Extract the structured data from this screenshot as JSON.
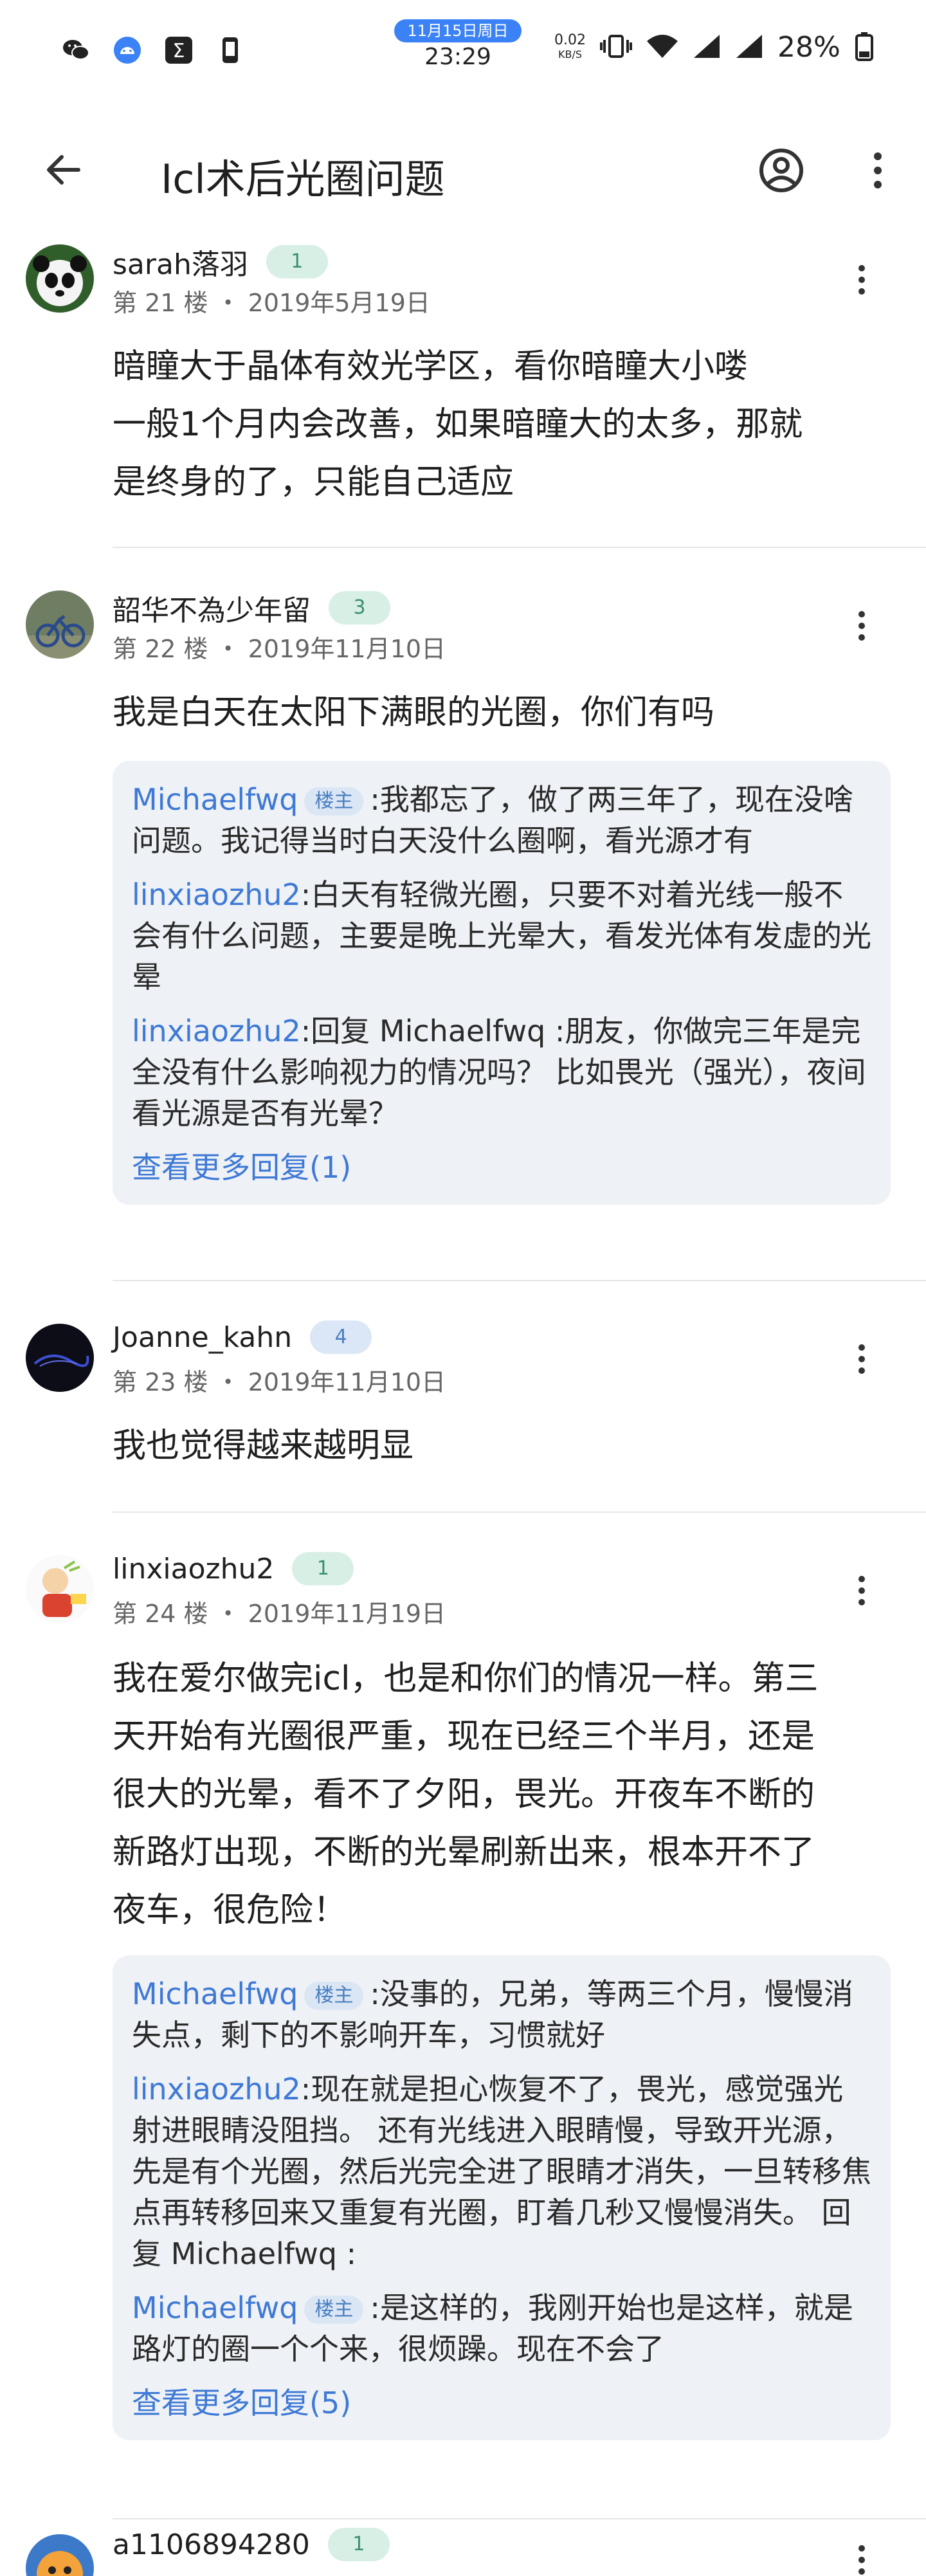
{
  "status_bar": {
    "date": "11月15日周日",
    "time": "23:29",
    "net_speed_value": "0.02",
    "net_speed_unit": "KB/S",
    "battery": "28%",
    "left_icons": [
      "wechat-icon",
      "android-icon",
      "sigma-icon",
      "phone-icon"
    ]
  },
  "app_bar": {
    "title": "Icl术后光圈问题"
  },
  "posts": [
    {
      "user": "sarah落羽",
      "level": "1",
      "meta": "第 21 楼 ・ 2019年5月19日",
      "lines": [
        "暗瞳大于晶体有效光学区，看你暗瞳大小喽",
        "一般1个月内会改善，如果暗瞳大的太多，那就",
        "是终身的了，只能自己适应"
      ]
    },
    {
      "user": "韶华不為少年留",
      "level": "3",
      "meta": "第 22 楼 ・ 2019年11月10日",
      "lines": [
        "我是白天在太阳下满眼的光圈，你们有吗"
      ],
      "replies": [
        {
          "user": "Michaelfwq",
          "badge": "楼主",
          "text": ":我都忘了，做了两三年了，现在没啥问题。我记得当时白天没什么圈啊，看光源才有"
        },
        {
          "user": "linxiaozhu2",
          "text": ":白天有轻微光圈，只要不对着光线一般不会有什么问题，主要是晚上光晕大，看发光体有发虚的光晕"
        },
        {
          "user": "linxiaozhu2",
          "text": ":回复 Michaelfwq :朋友，你做完三年是完全没有什么影响视力的情况吗？ 比如畏光（强光），夜间看光源是否有光晕？"
        }
      ],
      "more_replies": "查看更多回复(1)"
    },
    {
      "user": "Joanne_kahn",
      "level": "4",
      "meta": "第 23 楼 ・ 2019年11月10日",
      "lines": [
        "我也觉得越来越明显"
      ]
    },
    {
      "user": "linxiaozhu2",
      "level": "1",
      "meta": "第 24 楼 ・ 2019年11月19日",
      "lines": [
        "我在爱尔做完icl，也是和你们的情况一样。第三",
        "天开始有光圈很严重，现在已经三个半月，还是",
        "很大的光晕，看不了夕阳，畏光。开夜车不断的",
        "新路灯出现，不断的光晕刷新出来，根本开不了",
        "夜车，很危险！"
      ],
      "replies": [
        {
          "user": "Michaelfwq",
          "badge": "楼主",
          "text": ":没事的，兄弟，等两三个月，慢慢消失点，剩下的不影响开车，习惯就好"
        },
        {
          "user": "linxiaozhu2",
          "text": ":现在就是担心恢复不了，畏光，感觉强光射进眼睛没阻挡。 还有光线进入眼睛慢，导致开光源，先是有个光圈，然后光完全进了眼睛才消失，一旦转移焦点再转移回来又重复有光圈，盯着几秒又慢慢消失。 回复 Michaelfwq :"
        },
        {
          "user": "Michaelfwq",
          "badge": "楼主",
          "text": ":是这样的，我刚开始也是这样，就是路灯的圈一个个来，很烦躁。现在不会了"
        }
      ],
      "more_replies": "查看更多回复(5)"
    },
    {
      "user": "a1106894280",
      "level": "1"
    }
  ],
  "colors": {
    "link": "#3e79d6",
    "reply_bg": "#eef1f5",
    "level_green_bg": "#d8efe6",
    "level_blue_bg": "#dbe7f6"
  }
}
